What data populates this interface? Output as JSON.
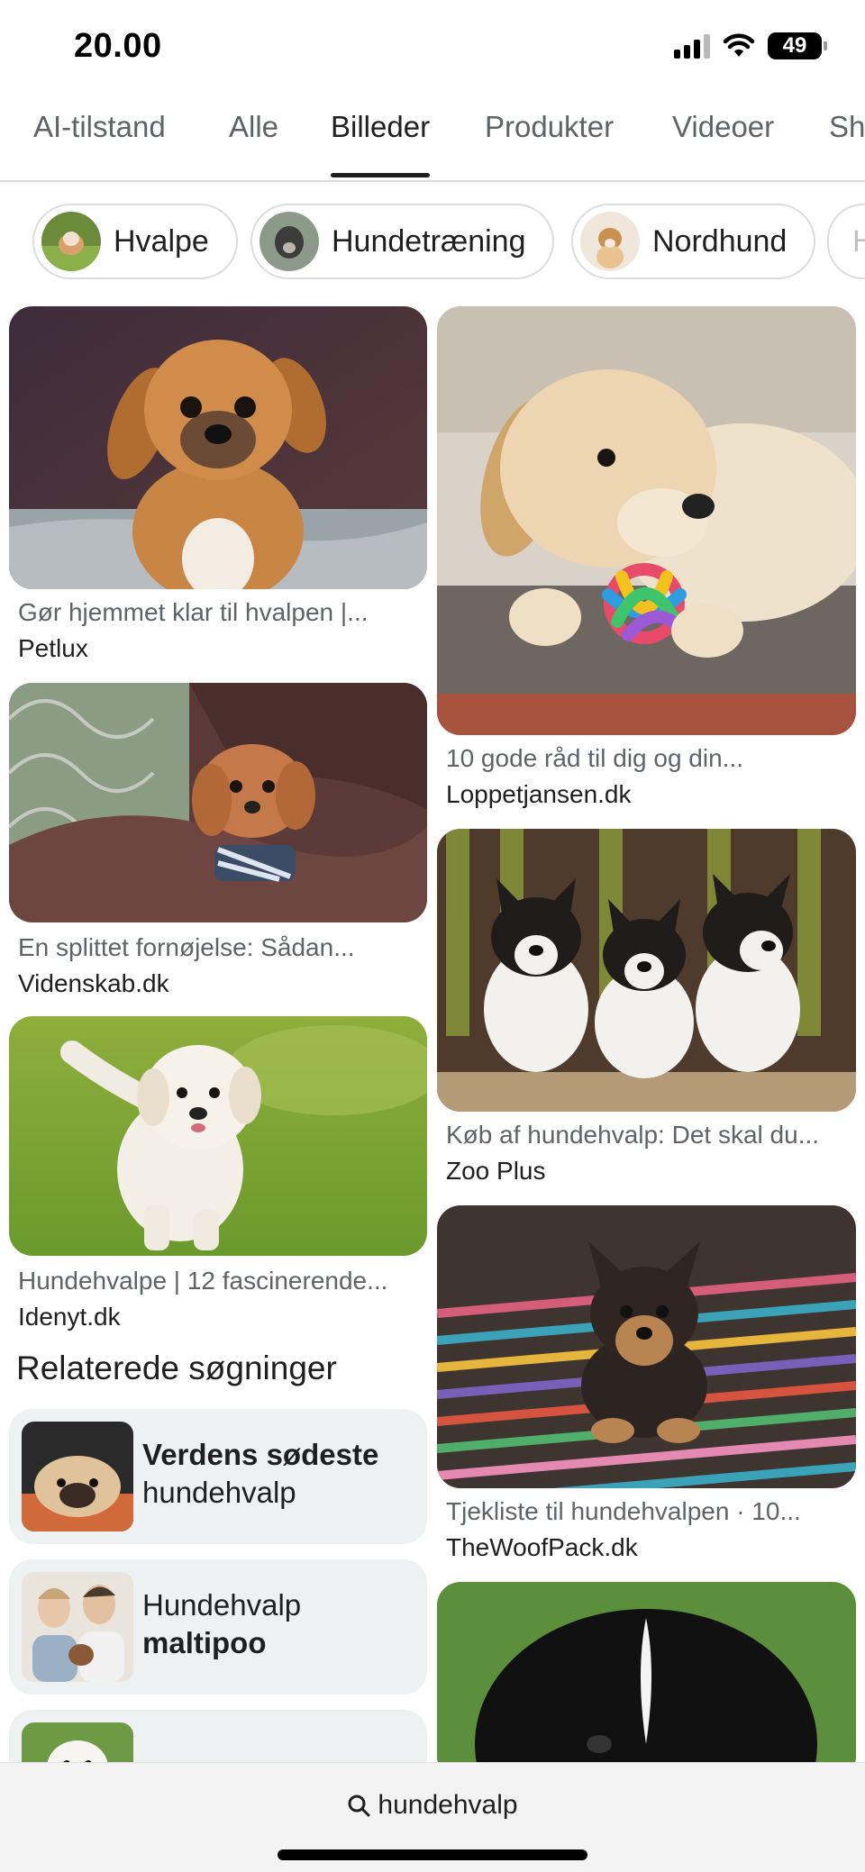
{
  "status_bar": {
    "time": "20.00",
    "battery": "49",
    "icons": [
      "signal-icon",
      "wifi-icon",
      "battery-icon"
    ]
  },
  "tabs": [
    {
      "label": "AI-tilstand",
      "active": false
    },
    {
      "label": "Alle",
      "active": false
    },
    {
      "label": "Billeder",
      "active": true
    },
    {
      "label": "Produkter",
      "active": false
    },
    {
      "label": "Videoer",
      "active": false
    },
    {
      "label": "Sh",
      "active": false
    }
  ],
  "chips": [
    {
      "label": "Hvalpe"
    },
    {
      "label": "Hundetræning"
    },
    {
      "label": "Nordhund"
    },
    {
      "label": "H"
    }
  ],
  "results": [
    {
      "caption": "Gør hjemmet klar til hvalpen |...",
      "source": "Petlux"
    },
    {
      "caption": "En splittet fornøjelse: Sådan...",
      "source": "Videnskab.dk"
    },
    {
      "caption": "Hundehvalpe | 12 fascinerende...",
      "source": "Idenyt.dk"
    },
    {
      "caption": "10 gode råd til dig og din...",
      "source": "Loppetjansen.dk"
    },
    {
      "caption": "Køb af hundehvalp: Det skal du...",
      "source": "Zoo Plus"
    },
    {
      "caption": "Tjekliste til hundehvalpen · 10...",
      "source": "TheWoofPack.dk"
    }
  ],
  "related": {
    "title": "Relaterede søgninger",
    "items": [
      {
        "bold": "Verdens sødeste",
        "normal": "hundehvalp"
      },
      {
        "normal": "Hundehvalp",
        "bold": "maltipoo"
      }
    ]
  },
  "search": {
    "query": "hundehvalp",
    "icon": "search-icon"
  }
}
